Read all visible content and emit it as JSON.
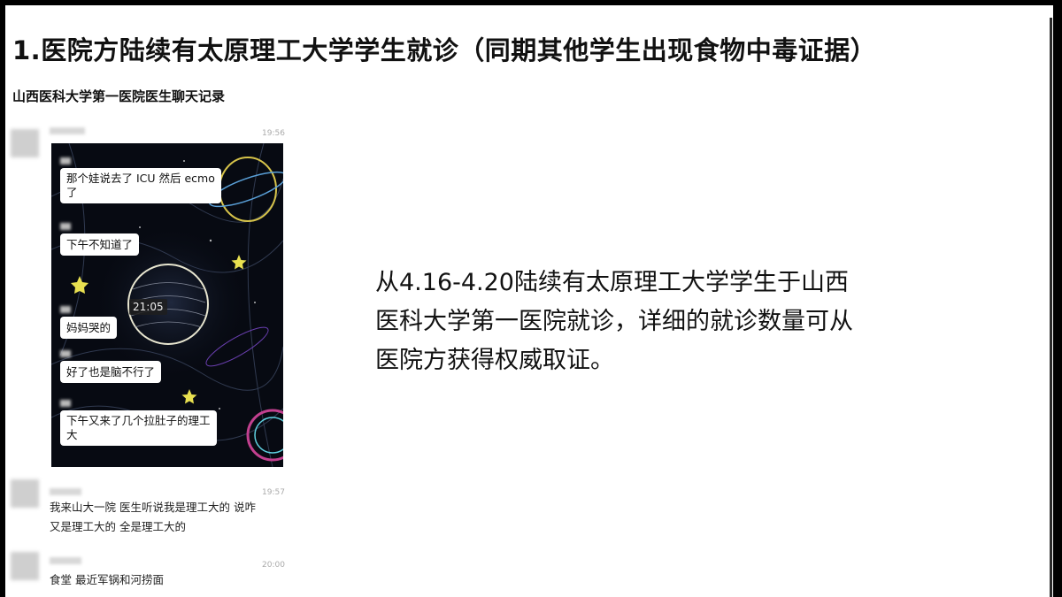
{
  "title": "1.医院方陆续有太原理工大学学生就诊（同期其他学生出现食物中毒证据）",
  "subtitle": "山西医科大学第一医院医生聊天记录",
  "chat": {
    "time1": "19:56",
    "bubbles": [
      "那个娃说去了 ICU 然后 ecmo",
      "了",
      "下午不知道了",
      "妈妈哭的",
      "好了也是脑不行了",
      "下午又来了几个拉肚子的理工",
      "大"
    ],
    "photo_time": "21:05",
    "time2": "19:57",
    "msg2_line1": "我来山大一院 医生听说我是理工大的 说咋",
    "msg2_line2": "又是理工大的 全是理工大的",
    "time3": "20:00",
    "msg3": "食堂 最近军锅和河捞面"
  },
  "body": {
    "line1": " 从4.16-4.20陆续有太原理工大学学生于山西",
    "line2": "医科大学第一医院就诊，详细的就诊数量可从",
    "line3": "医院方获得权威取证。"
  }
}
